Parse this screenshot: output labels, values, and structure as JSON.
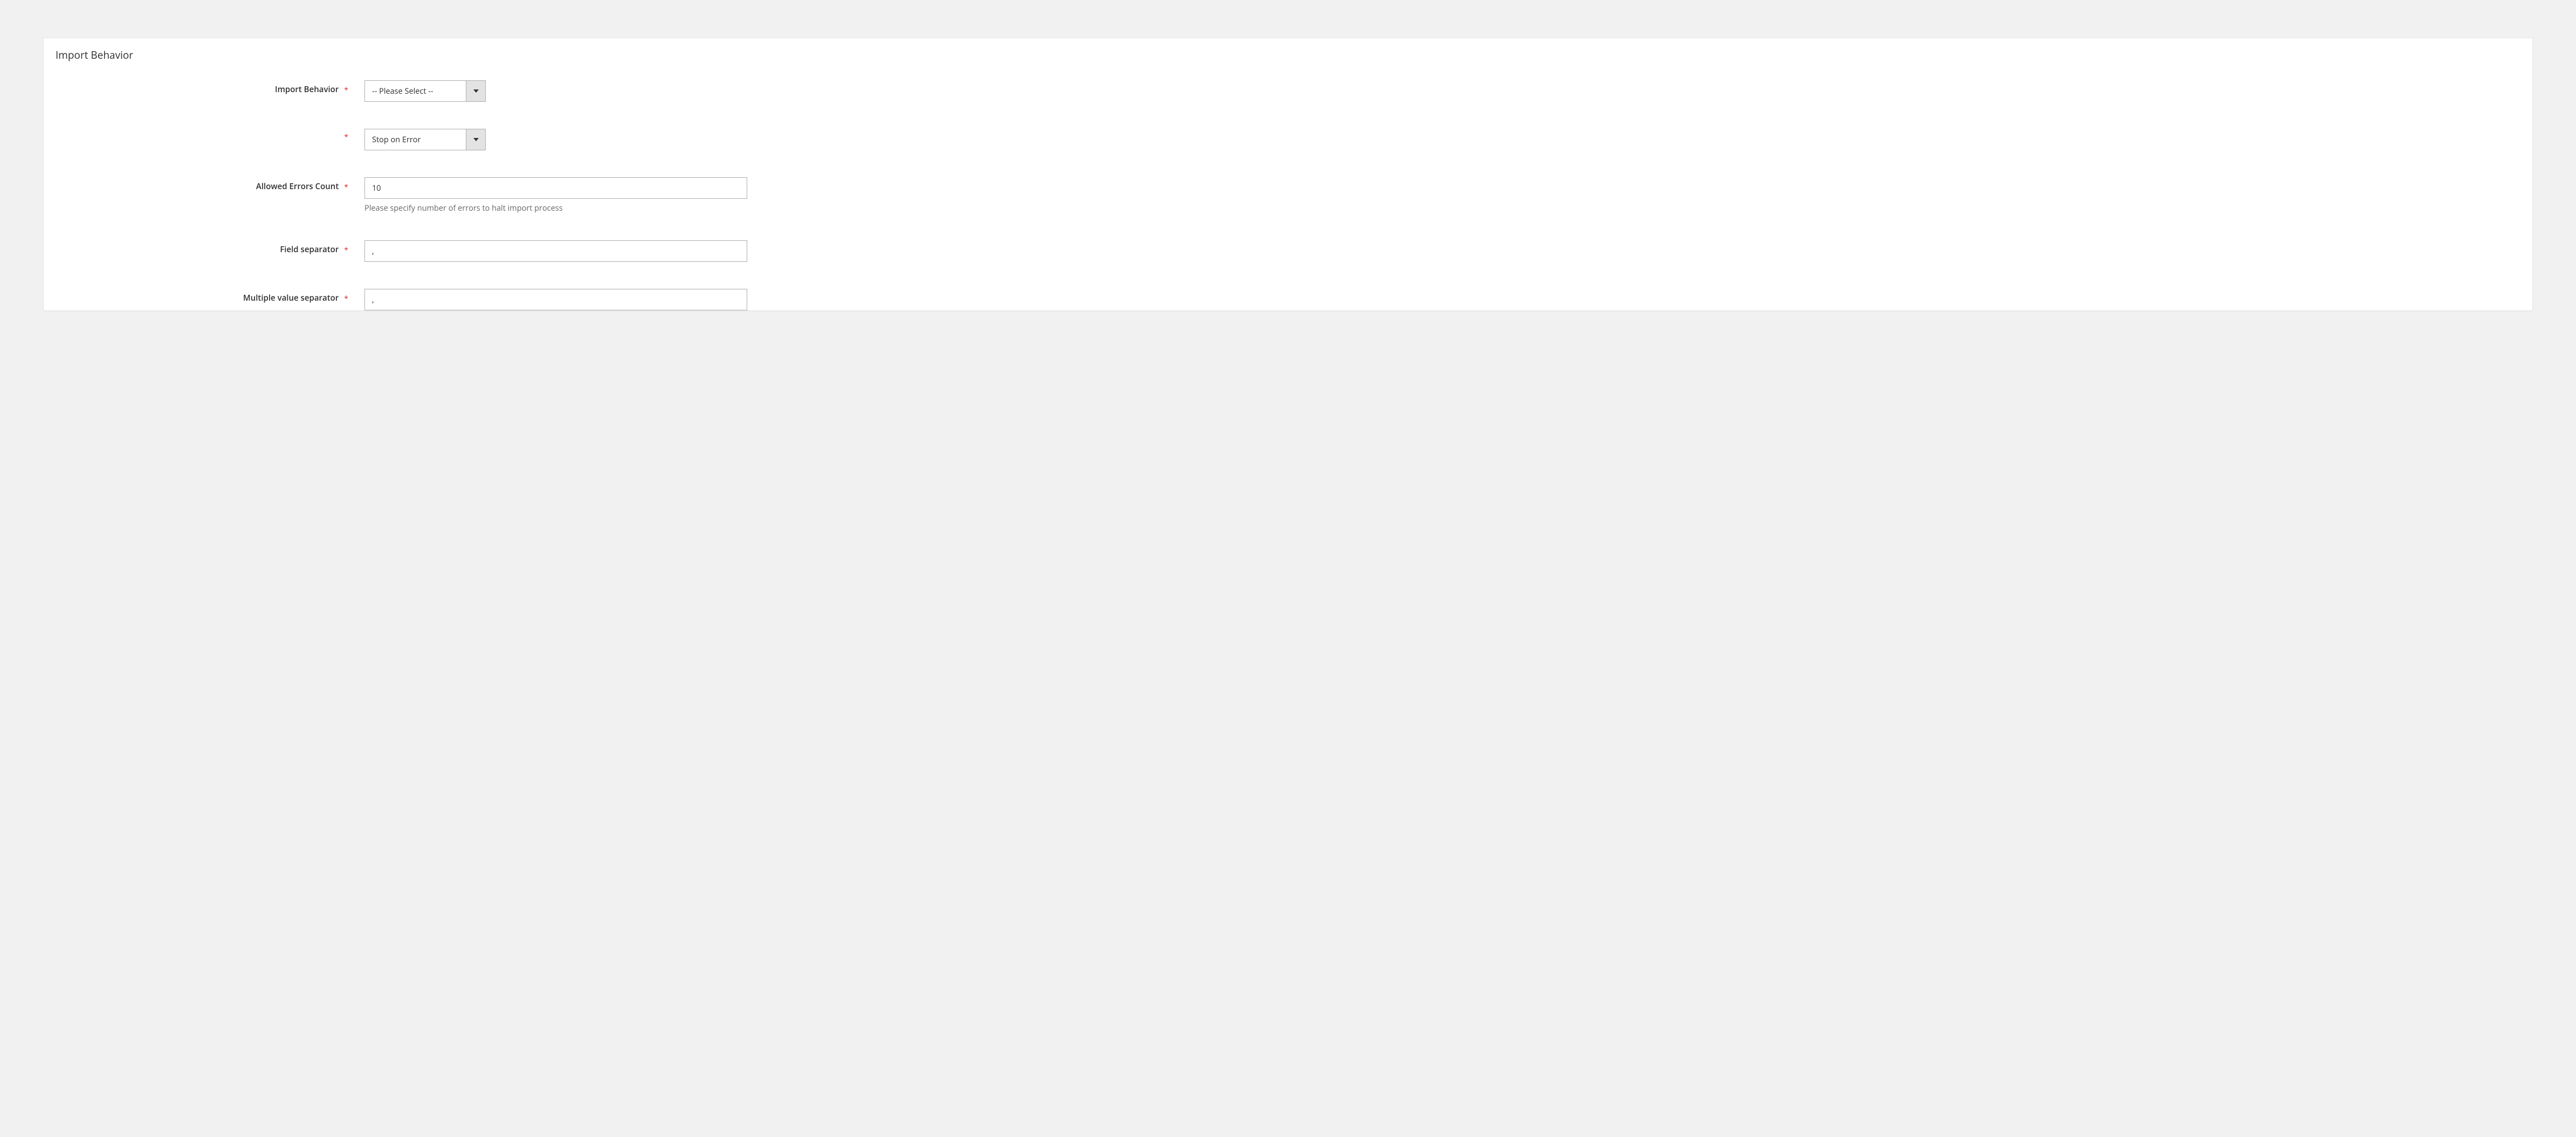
{
  "section": {
    "title": "Import Behavior",
    "fields": {
      "import_behavior": {
        "label": "Import Behavior",
        "value": "-- Please Select --"
      },
      "error_strategy": {
        "label": "",
        "value": "Stop on Error"
      },
      "allowed_errors_count": {
        "label": "Allowed Errors Count",
        "value": "10",
        "help": "Please specify number of errors to halt import process"
      },
      "field_separator": {
        "label": "Field separator",
        "value": ","
      },
      "multiple_value_separator": {
        "label": "Multiple value separator",
        "value": ","
      }
    }
  }
}
